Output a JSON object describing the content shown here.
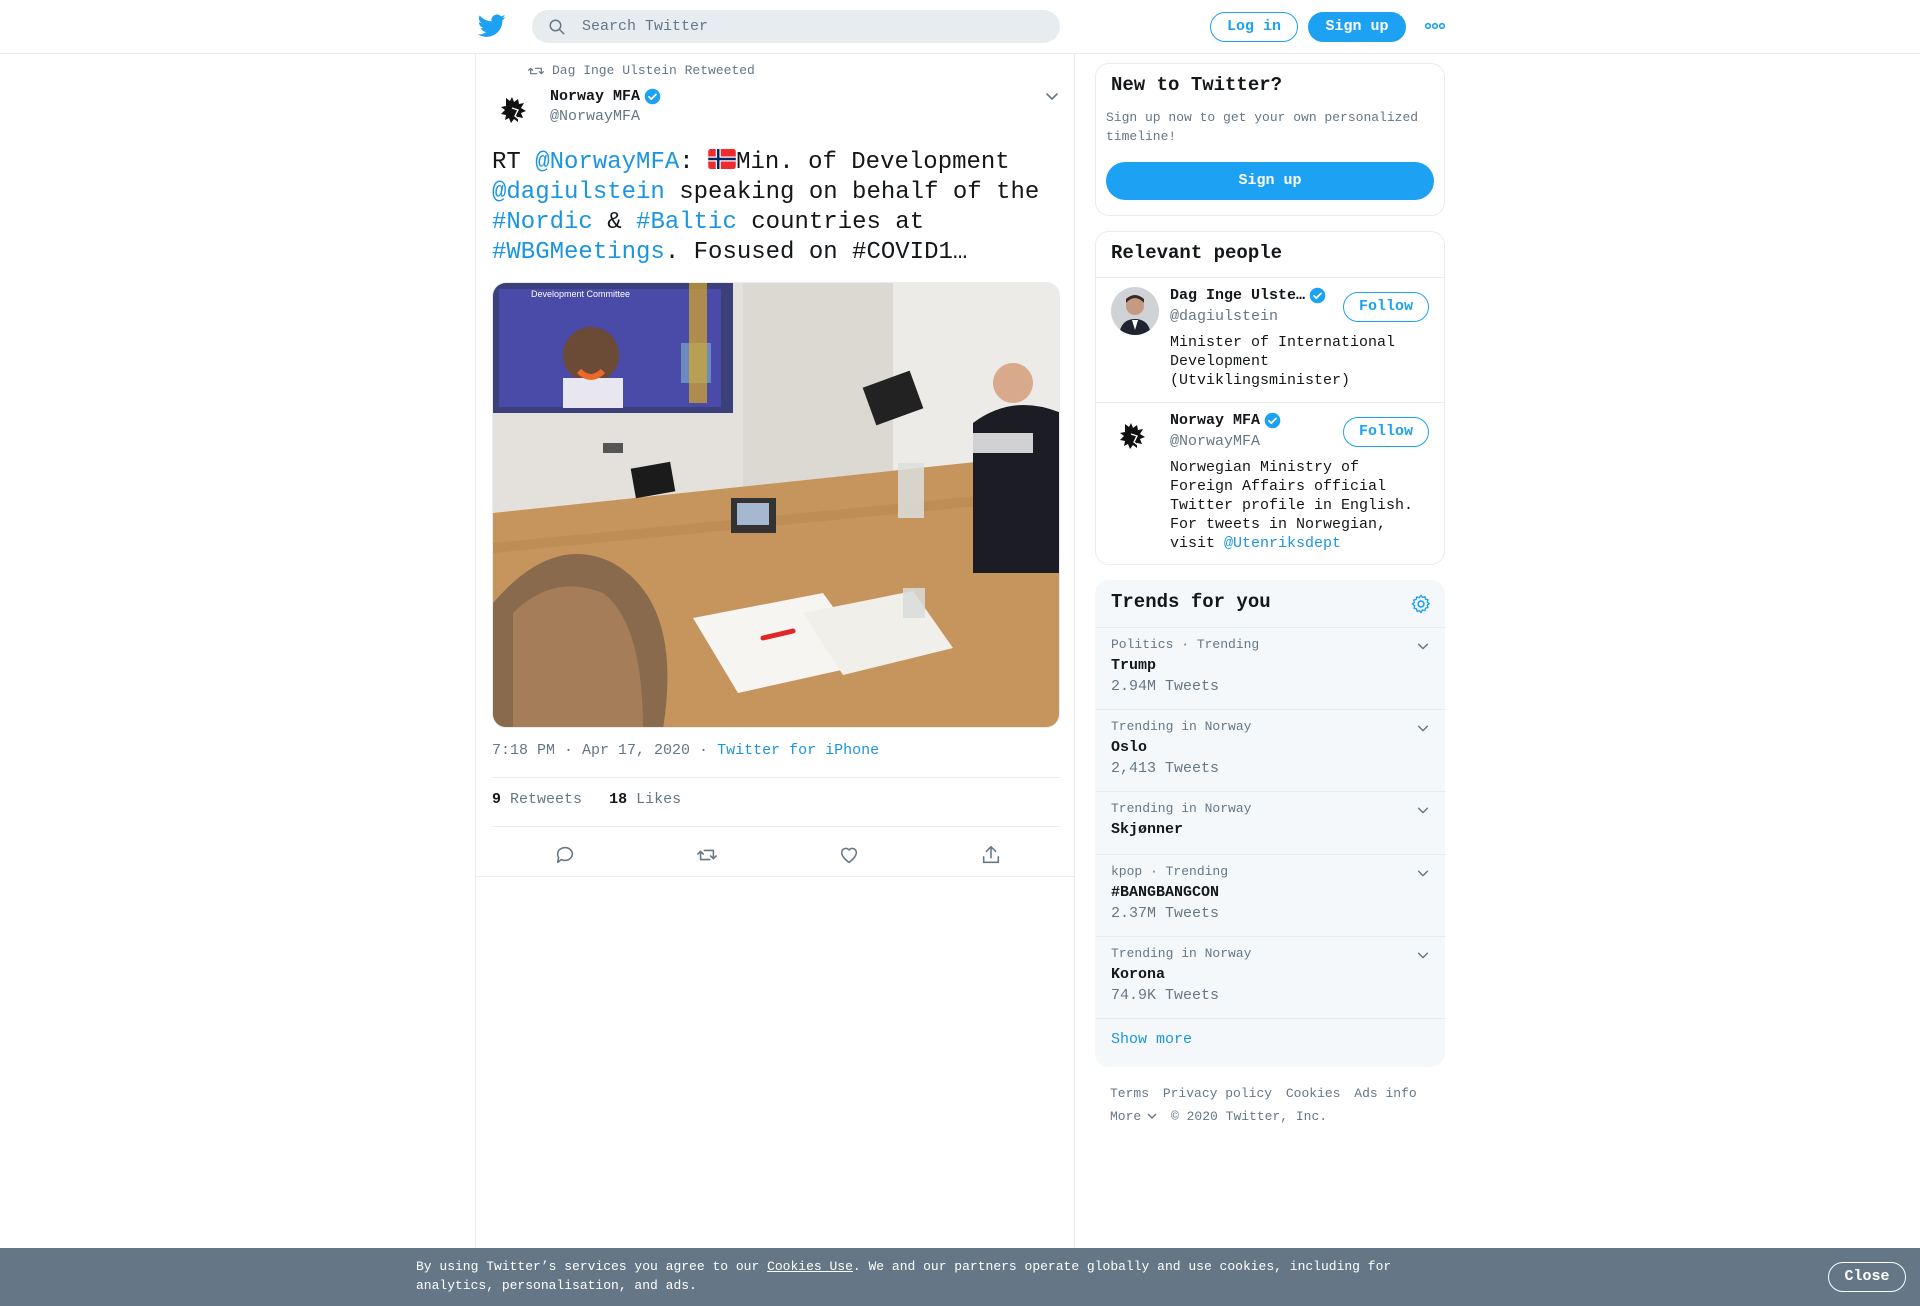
{
  "header": {
    "search_placeholder": "Search Twitter",
    "login_label": "Log in",
    "signup_label": "Sign up"
  },
  "tweet": {
    "retweeted_by": "Dag Inge Ulstein Retweeted",
    "author_name": "Norway MFA",
    "author_handle": "@NorwayMFA",
    "text_parts": {
      "rt": "RT ",
      "mention1": "@NorwayMFA",
      "colon": ": ",
      "t1": "Min. of Development ",
      "mention2": "@dagiulstein",
      "t2": " speaking on behalf of the ",
      "hash1": "#Nordic",
      "t3": " & ",
      "hash2": "#Baltic",
      "t4": " countries at ",
      "hash3": "#WBGMeetings",
      "t5": ". Fosused on #COVID1…"
    },
    "photo_overlay": "Development Committee",
    "timestamp": "7:18 PM · Apr 17, 2020",
    "separator": " · ",
    "source": "Twitter for iPhone",
    "retweets_count": "9",
    "retweets_label": "Retweets",
    "likes_count": "18",
    "likes_label": "Likes"
  },
  "sidebar": {
    "new_title": "New to Twitter?",
    "new_sub": "Sign up now to get your own personalized timeline!",
    "new_signup": "Sign up",
    "relevant_title": "Relevant people",
    "people": [
      {
        "name": "Dag Inge Ulste…",
        "handle": "@dagiulstein",
        "bio": "Minister of International Development (Utviklingsminister)",
        "follow": "Follow"
      },
      {
        "name": "Norway MFA",
        "handle": "@NorwayMFA",
        "bio": "Norwegian Ministry of Foreign Affairs official Twitter profile in English. For tweets in Norwegian, visit ",
        "bio_link": "@Utenriksdept",
        "follow": "Follow"
      }
    ],
    "trends_title": "Trends for you",
    "trends": [
      {
        "meta": "Politics · Trending",
        "name": "Trump",
        "count": "2.94M Tweets"
      },
      {
        "meta": "Trending in Norway",
        "name": "Oslo",
        "count": "2,413 Tweets"
      },
      {
        "meta": "Trending in Norway",
        "name": "Skjønner",
        "count": ""
      },
      {
        "meta": "kpop · Trending",
        "name": "#BANGBANGCON",
        "count": "2.37M Tweets"
      },
      {
        "meta": "Trending in Norway",
        "name": "Korona",
        "count": "74.9K Tweets"
      }
    ],
    "show_more": "Show more",
    "footer": {
      "terms": "Terms",
      "privacy": "Privacy policy",
      "cookies": "Cookies",
      "ads": "Ads info",
      "more": "More",
      "copyright": "© 2020 Twitter, Inc."
    }
  },
  "cookie_bar": {
    "text_before": "By using Twitter’s services you agree to our ",
    "link": "Cookies Use",
    "text_after": ". We and our partners operate globally and use cookies, including for analytics, personalisation, and ads.",
    "close": "Close"
  },
  "colors": {
    "brand": "#1da1f2",
    "link": "#1b95e0",
    "muted": "#657786",
    "cookie_bar": "#657786"
  },
  "icons": [
    "twitter-bird-icon",
    "search-icon",
    "more-dots-icon",
    "retweet-icon",
    "verified-icon",
    "chevron-down-icon",
    "reply-icon",
    "like-icon",
    "share-icon",
    "gear-icon"
  ]
}
